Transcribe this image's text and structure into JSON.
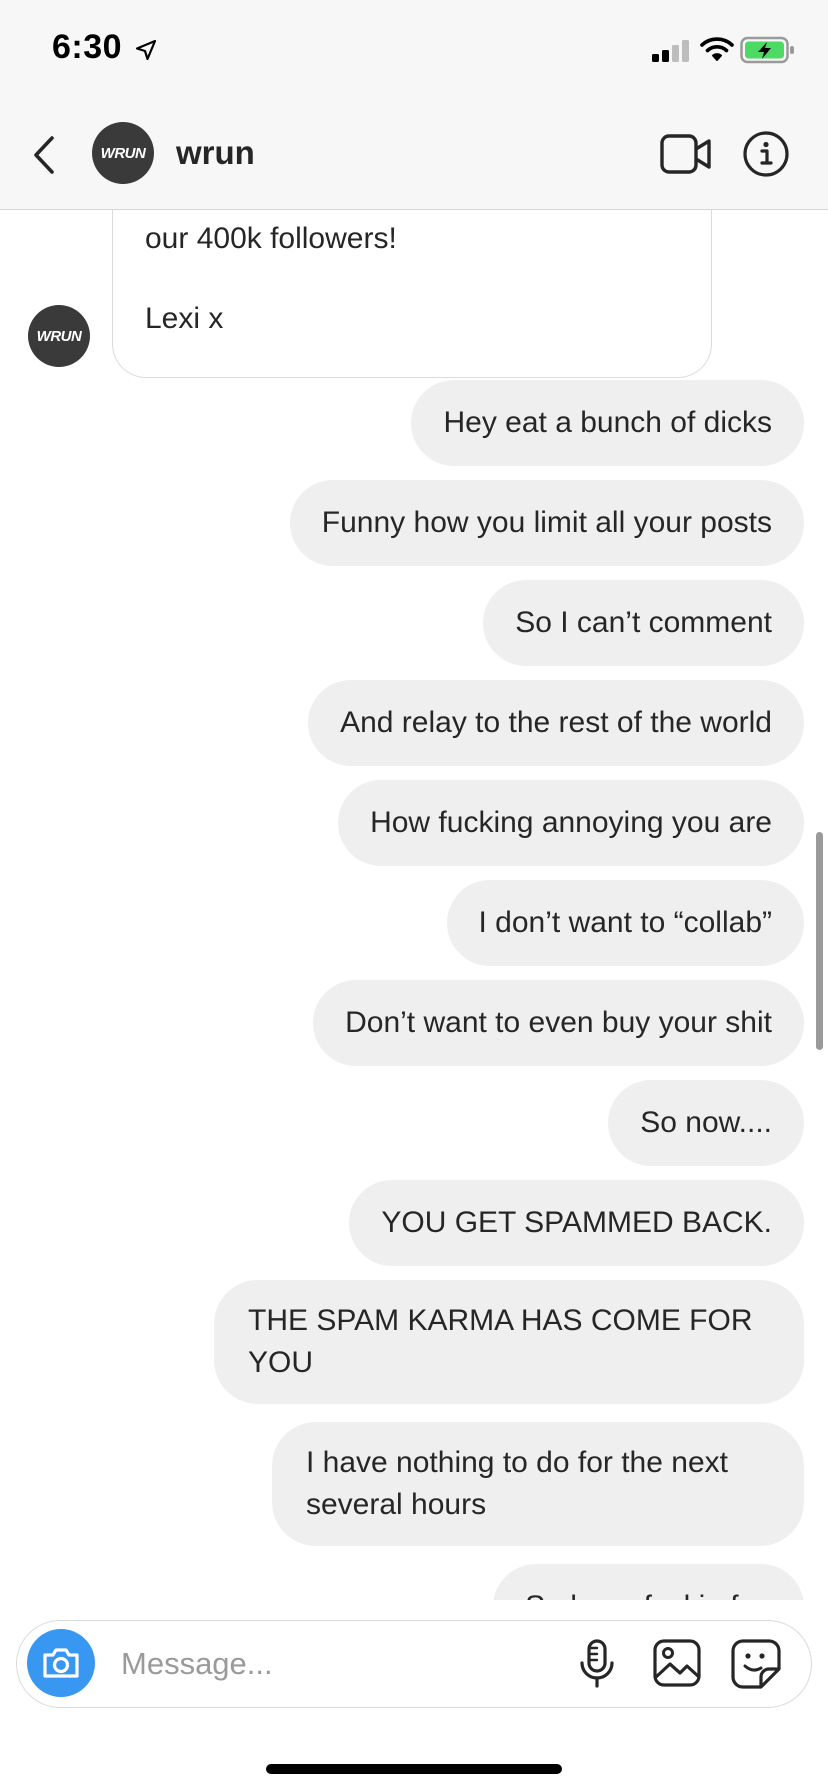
{
  "status_bar": {
    "time": "6:30"
  },
  "header": {
    "avatar_text": "WRUN",
    "name": "wrun"
  },
  "incoming": {
    "lines": [
      "our 400k followers!",
      "Lexi x"
    ],
    "avatar_text": "WRUN"
  },
  "messages": [
    "Hey eat a bunch of dicks",
    "Funny how you limit all your posts",
    "So I can’t comment",
    "And relay to the rest of the world",
    "How fucking annoying you are",
    "I don’t want to “collab”",
    "Don’t want to even buy your shit",
    "So now....",
    "YOU GET SPAMMED BACK.",
    "THE SPAM KARMA HAS COME FOR YOU",
    "I have nothing to do for the next several hours",
    "So have fuckin fun"
  ],
  "composer": {
    "placeholder": "Message..."
  },
  "colors": {
    "bubble_bg": "#efefef",
    "header_bg": "#f7f7f7",
    "camera_blue": "#3897f0",
    "battery_green": "#4cd964"
  }
}
